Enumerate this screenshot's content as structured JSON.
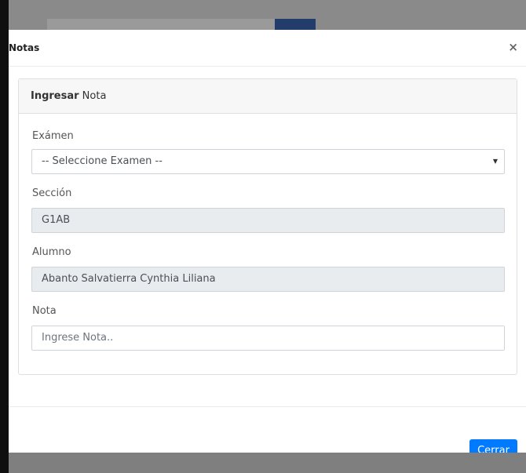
{
  "modal": {
    "title": "Notas",
    "close_icon": "×"
  },
  "card": {
    "header_bold": "Ingresar",
    "header_rest": " Nota"
  },
  "form": {
    "examen_label": "Exámen",
    "examen_selected": "-- Seleccione Examen --",
    "seccion_label": "Sección",
    "seccion_value": "G1AB",
    "alumno_label": "Alumno",
    "alumno_value": "Abanto Salvatierra Cynthia Liliana",
    "nota_label": "Nota",
    "nota_placeholder": "Ingrese Nota..",
    "nota_value": ""
  },
  "footer": {
    "close_label": "Cerrar"
  },
  "colors": {
    "primary": "#007bff",
    "backdrop": "#7f7f7f",
    "readonly_bg": "#e9ecef"
  }
}
